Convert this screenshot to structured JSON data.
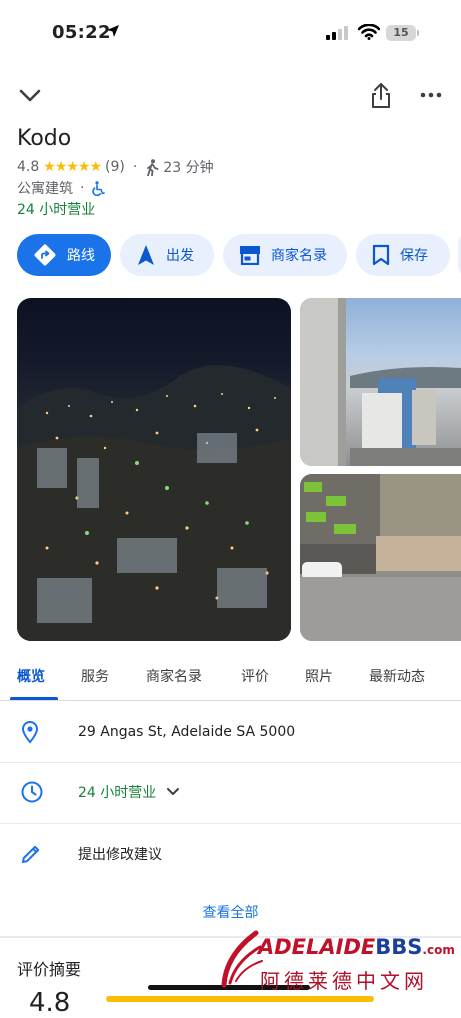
{
  "status_bar": {
    "time": "05:22",
    "battery": "15"
  },
  "place": {
    "name": "Kodo",
    "rating": "4.8",
    "stars": "★★★★★",
    "review_count": "(9)",
    "walk_time": "23 分钟",
    "category": "公寓建筑",
    "separator": "·",
    "open_status": "24 小时营业"
  },
  "actions": {
    "route": "路线",
    "start": "出发",
    "directory": "商家名录",
    "save": "保存"
  },
  "tabs": [
    "概览",
    "服务",
    "商家名录",
    "评价",
    "照片",
    "最新动态"
  ],
  "info": {
    "address": "29 Angas St, Adelaide SA 5000",
    "hours": "24 小时营业",
    "suggest_edit": "提出修改建议",
    "see_all": "查看全部"
  },
  "reviews": {
    "title": "评价摘要",
    "rating": "4.8"
  },
  "watermark": {
    "brand_a": "ADELAIDE",
    "brand_b": "BBS",
    "brand_c": ".com",
    "cn": "阿德莱德中文网"
  },
  "colors": {
    "accent": "#1a73e8",
    "chip_bg": "#e8f0fe",
    "open_green": "#188038",
    "star": "#fbbc04"
  }
}
